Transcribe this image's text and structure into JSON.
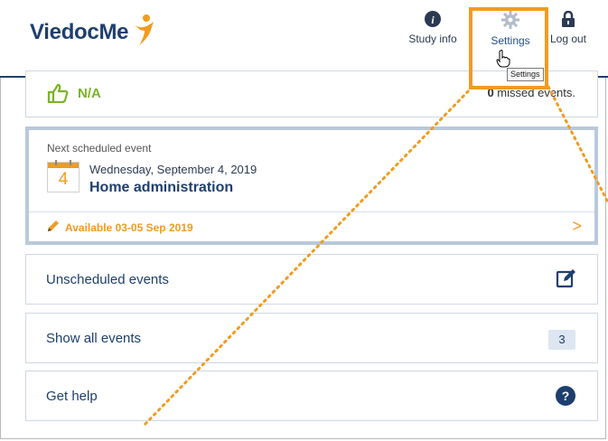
{
  "app": {
    "logo_text": "ViedocMe"
  },
  "nav": {
    "study_info": "Study info",
    "settings": "Settings",
    "log_out": "Log out",
    "tooltip": "Settings"
  },
  "status": {
    "value": "N/A",
    "missed_count": "0",
    "missed_label": "missed events."
  },
  "next_event": {
    "label": "Next scheduled event",
    "date": "Wednesday, September 4, 2019",
    "day": "4",
    "name": "Home administration",
    "availability": "Available 03-05 Sep 2019",
    "chevron": ">"
  },
  "rows": {
    "unscheduled": "Unscheduled events",
    "show_all": "Show all events",
    "show_all_count": "3",
    "help": "Get help",
    "help_icon": "?"
  },
  "colors": {
    "accent": "#f29b1f",
    "brand": "#1e3f6e",
    "success": "#7bb327"
  }
}
